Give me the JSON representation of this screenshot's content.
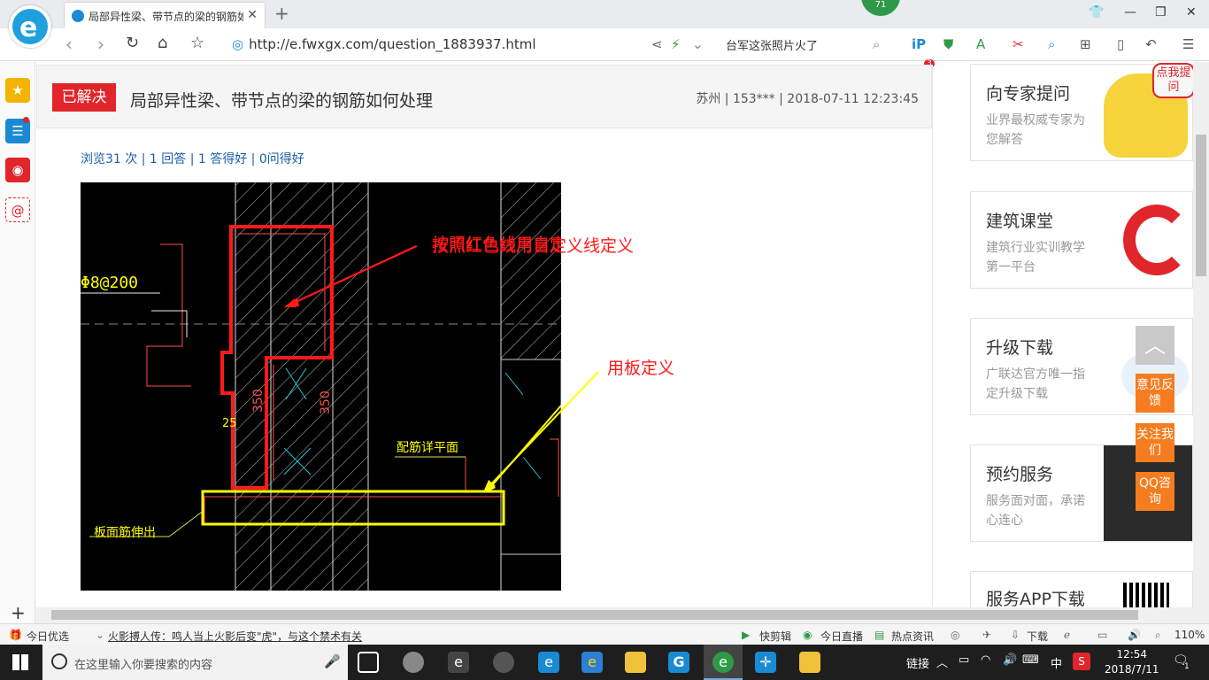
{
  "browser": {
    "tab_title": "局部异性梁、带节点的梁的钢筋如何处理",
    "badge_count": "71",
    "url": "http://e.fwxgx.com/question_1883937.html",
    "search_hint": "台军这张照片火了",
    "notification_count": "3"
  },
  "question": {
    "status": "已解决",
    "title": "局部异性梁、带节点的梁的钢筋如何处理",
    "meta": "苏州 | 153*** | 2018-07-11 12:23:45",
    "stats": "浏览31 次 | 1 回答 | 1 答得好 | 0问得好"
  },
  "cad": {
    "label_rebar": "Φ8@200",
    "annotation_red": "按照红色线用自定义线定义",
    "annotation_yellow": "用板定义",
    "label_350a": "350",
    "label_350b": "350",
    "label_25": "25",
    "label_plane": "配筋详平面",
    "label_slab": "板面筋伸出"
  },
  "sidebar_cards": [
    {
      "title": "向专家提问",
      "subtitle": "业界最权威专家为您解答",
      "badge": "点我提问"
    },
    {
      "title": "建筑课堂",
      "subtitle": "建筑行业实训教学第一平台"
    },
    {
      "title": "升级下载",
      "subtitle": "广联达官方唯一指定升级下载"
    },
    {
      "title": "预约服务",
      "subtitle": "服务面对面，承诺心连心"
    },
    {
      "title": "服务APP下载"
    }
  ],
  "float_buttons": [
    "意见反馈",
    "关注我们",
    "QQ咨询"
  ],
  "status_bar": {
    "today": "今日优选",
    "headline": "火影搏人传：鸣人当上火影后变\"虎\"，与这个禁术有关",
    "items": [
      "快剪辑",
      "今日直播",
      "热点资讯",
      "下载"
    ],
    "zoom": "110%"
  },
  "taskbar": {
    "search_placeholder": "在这里输入你要搜索的内容",
    "tray_link": "链接",
    "ime": "中",
    "time": "12:54",
    "date": "2018/7/11",
    "notify": "1"
  },
  "colors": {
    "solved": "#e0262a",
    "link": "#1a5fa8",
    "accent": "#f57c1f",
    "cad_red": "#ff1a1a",
    "cad_yellow": "#ffff00"
  }
}
